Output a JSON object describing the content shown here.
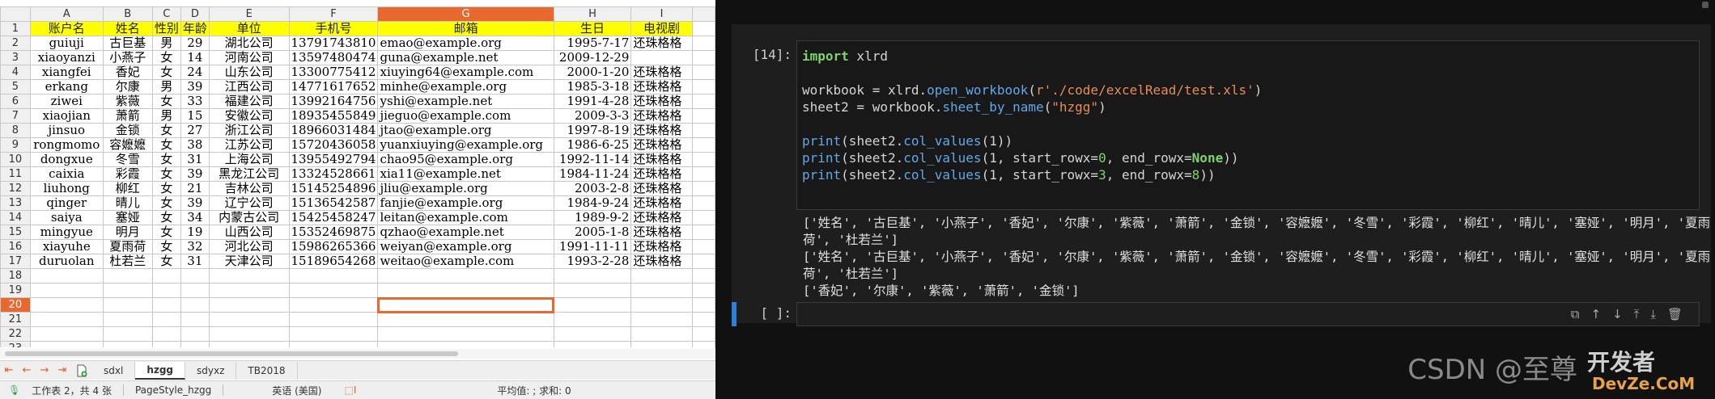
{
  "spreadsheet": {
    "columns": [
      "A",
      "B",
      "C",
      "D",
      "E",
      "F",
      "G",
      "H",
      "I"
    ],
    "selected_column": "G",
    "selected_row": "20",
    "header_row": [
      "账户名",
      "姓名",
      "性别",
      "年龄",
      "单位",
      "手机号",
      "邮箱",
      "生日",
      "电视剧"
    ],
    "rows": [
      [
        "guiuji",
        "古巨基",
        "男",
        "29",
        "湖北公司",
        "13791743810",
        "emao@example.org",
        "1995-7-17",
        "还珠格格"
      ],
      [
        "xiaoyanzi",
        "小燕子",
        "女",
        "14",
        "河南公司",
        "13597480474",
        "guna@example.net",
        "2009-12-29",
        ""
      ],
      [
        "xiangfei",
        "香妃",
        "女",
        "24",
        "山东公司",
        "13300775412",
        "xiuying64@example.com",
        "2000-1-20",
        "还珠格格"
      ],
      [
        "erkang",
        "尔康",
        "男",
        "39",
        "江西公司",
        "14771617652",
        "minhe@example.org",
        "1985-3-18",
        "还珠格格"
      ],
      [
        "ziwei",
        "紫薇",
        "女",
        "33",
        "福建公司",
        "13992164756",
        "yshi@example.net",
        "1991-4-28",
        "还珠格格"
      ],
      [
        "xiaojian",
        "萧箭",
        "男",
        "15",
        "安徽公司",
        "18935455849",
        "jieguo@example.com",
        "2009-3-3",
        "还珠格格"
      ],
      [
        "jinsuo",
        "金锁",
        "女",
        "27",
        "浙江公司",
        "18966031484",
        "jtao@example.org",
        "1997-8-19",
        "还珠格格"
      ],
      [
        "rongmomo",
        "容嬷嬷",
        "女",
        "38",
        "江苏公司",
        "15720436058",
        "yuanxiuying@example.org",
        "1986-6-25",
        "还珠格格"
      ],
      [
        "dongxue",
        "冬雪",
        "女",
        "31",
        "上海公司",
        "13955492794",
        "chao95@example.org",
        "1992-11-14",
        "还珠格格"
      ],
      [
        "caixia",
        "彩霞",
        "女",
        "39",
        "黑龙江公司",
        "13324528661",
        "xia11@example.net",
        "1984-11-24",
        "还珠格格"
      ],
      [
        "liuhong",
        "柳红",
        "女",
        "21",
        "吉林公司",
        "15145254896",
        "jliu@example.org",
        "2003-2-8",
        "还珠格格"
      ],
      [
        "qinger",
        "晴儿",
        "女",
        "39",
        "辽宁公司",
        "15136542587",
        "fanjie@example.org",
        "1984-9-24",
        "还珠格格"
      ],
      [
        "saiya",
        "塞娅",
        "女",
        "34",
        "内蒙古公司",
        "15425458247",
        "leitan@example.com",
        "1989-9-2",
        "还珠格格"
      ],
      [
        "mingyue",
        "明月",
        "女",
        "19",
        "山西公司",
        "15352469875",
        "qzhao@example.net",
        "2005-1-8",
        "还珠格格"
      ],
      [
        "xiayuhe",
        "夏雨荷",
        "女",
        "32",
        "河北公司",
        "15986265366",
        "weiyan@example.org",
        "1991-11-11",
        "还珠格格"
      ],
      [
        "duruolan",
        "杜若兰",
        "女",
        "31",
        "天津公司",
        "15189654268",
        "weitao@example.com",
        "1993-2-28",
        "还珠格格"
      ]
    ],
    "empty_rows": [
      "18",
      "19",
      "20",
      "21",
      "22",
      "23"
    ],
    "sheet_tabs": [
      "sdxl",
      "hzgg",
      "sdyxz",
      "TB2018"
    ],
    "active_tab": "hzgg",
    "status": {
      "sheet_info": "工作表 2，共 4 张",
      "page_style": "PageStyle_hzgg",
      "language": "英语 (美国)",
      "summary": "平均值: ; 求和: 0"
    }
  },
  "notebook": {
    "cell_prompt": "[14]:",
    "empty_prompt": "[ ]:",
    "code": {
      "line1_kw": "import",
      "line1_rest": " xlrd",
      "line3_a": "workbook = xlrd.",
      "line3_fn": "open_workbook",
      "line3_b": "(",
      "line3_str": "r'./code/excelRead/test.xls'",
      "line3_c": ")",
      "line4_a": "sheet2 = workbook.",
      "line4_fn": "sheet_by_name",
      "line4_b": "(",
      "line4_str": "\"hzgg\"",
      "line4_c": ")",
      "print": "print",
      "line6_a": "(sheet2.",
      "col_values": "col_values",
      "line6_b": "(1))",
      "line7_b": "(1, start_rowx=",
      "zero": "0",
      "line7_c": ", end_rowx=",
      "none": "None",
      "line7_d": "))",
      "line8_b": "(1, start_rowx=",
      "three": "3",
      "line8_c": ", end_rowx=",
      "eight": "8",
      "line8_d": "))"
    },
    "output": [
      "['姓名', '古巨基', '小燕子', '香妃', '尔康', '紫薇', '萧箭', '金锁', '容嬷嬷', '冬雪', '彩霞', '柳红', '晴儿', '塞娅', '明月', '夏雨",
      "荷', '杜若兰']",
      "['姓名', '古巨基', '小燕子', '香妃', '尔康', '紫薇', '萧箭', '金锁', '容嬷嬷', '冬雪', '彩霞', '柳红', '晴儿', '塞娅', '明月', '夏雨",
      "荷', '杜若兰']",
      "['香妃', '尔康', '紫薇', '萧箭', '金锁']"
    ],
    "tool_icons": [
      "copy-icon",
      "move-up-icon",
      "move-down-icon",
      "insert-above-icon",
      "insert-below-icon",
      "delete-icon"
    ]
  },
  "watermark": "CSDN @至尊",
  "watermark_logo": "开发者 DevZe.CoM"
}
